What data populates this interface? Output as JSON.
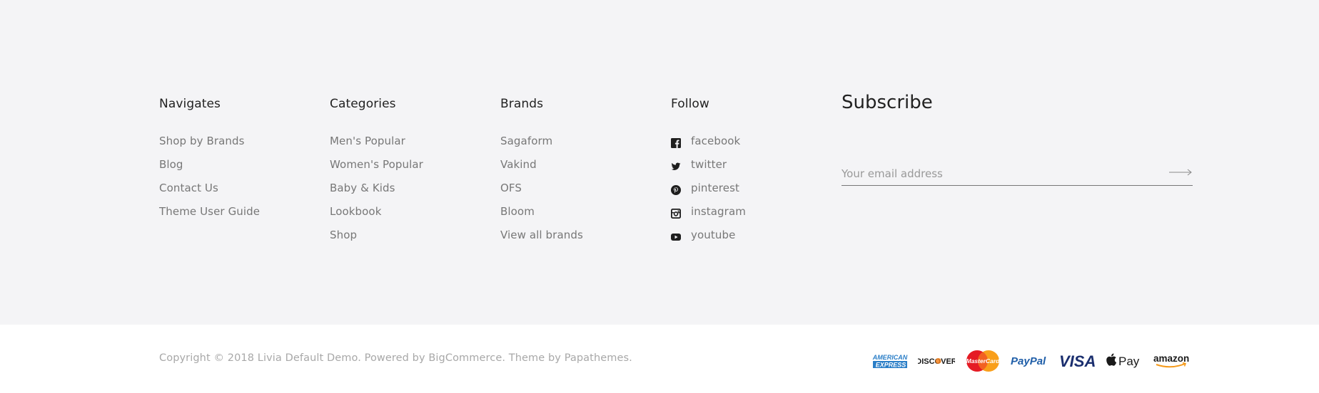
{
  "navigates": {
    "title": "Navigates",
    "items": [
      "Shop by Brands",
      "Blog",
      "Contact Us",
      "Theme User Guide"
    ]
  },
  "categories": {
    "title": "Categories",
    "items": [
      "Men's Popular",
      "Women's Popular",
      "Baby & Kids",
      "Lookbook",
      "Shop"
    ]
  },
  "brands": {
    "title": "Brands",
    "items": [
      "Sagaform",
      "Vakind",
      "OFS",
      "Bloom",
      "View all brands"
    ]
  },
  "follow": {
    "title": "Follow",
    "items": [
      {
        "label": "facebook",
        "icon": "facebook-icon"
      },
      {
        "label": "twitter",
        "icon": "twitter-icon"
      },
      {
        "label": "pinterest",
        "icon": "pinterest-icon"
      },
      {
        "label": "instagram",
        "icon": "instagram-icon"
      },
      {
        "label": "youtube",
        "icon": "youtube-icon"
      }
    ]
  },
  "subscribe": {
    "title": "Subscribe",
    "placeholder": "Your email address",
    "submit_icon": "arrow-right-icon"
  },
  "bottom": {
    "copyright": "Copyright © 2018 Livia Default Demo.  Powered by BigCommerce. Theme by Papathemes.",
    "payments": {
      "amex_line1": "AMERICAN",
      "amex_line2": "EXPRESS",
      "discover": "DISCOVER",
      "mastercard": "MasterCard",
      "paypal": "PayPal",
      "visa": "VISA",
      "applepay": "Pay",
      "amazon": "amazon"
    }
  },
  "colors": {
    "top_background": "#f4f4f6",
    "bottom_background": "#ffffff",
    "heading": "#222222",
    "link": "#777777",
    "copyright": "#a8a8a8"
  }
}
